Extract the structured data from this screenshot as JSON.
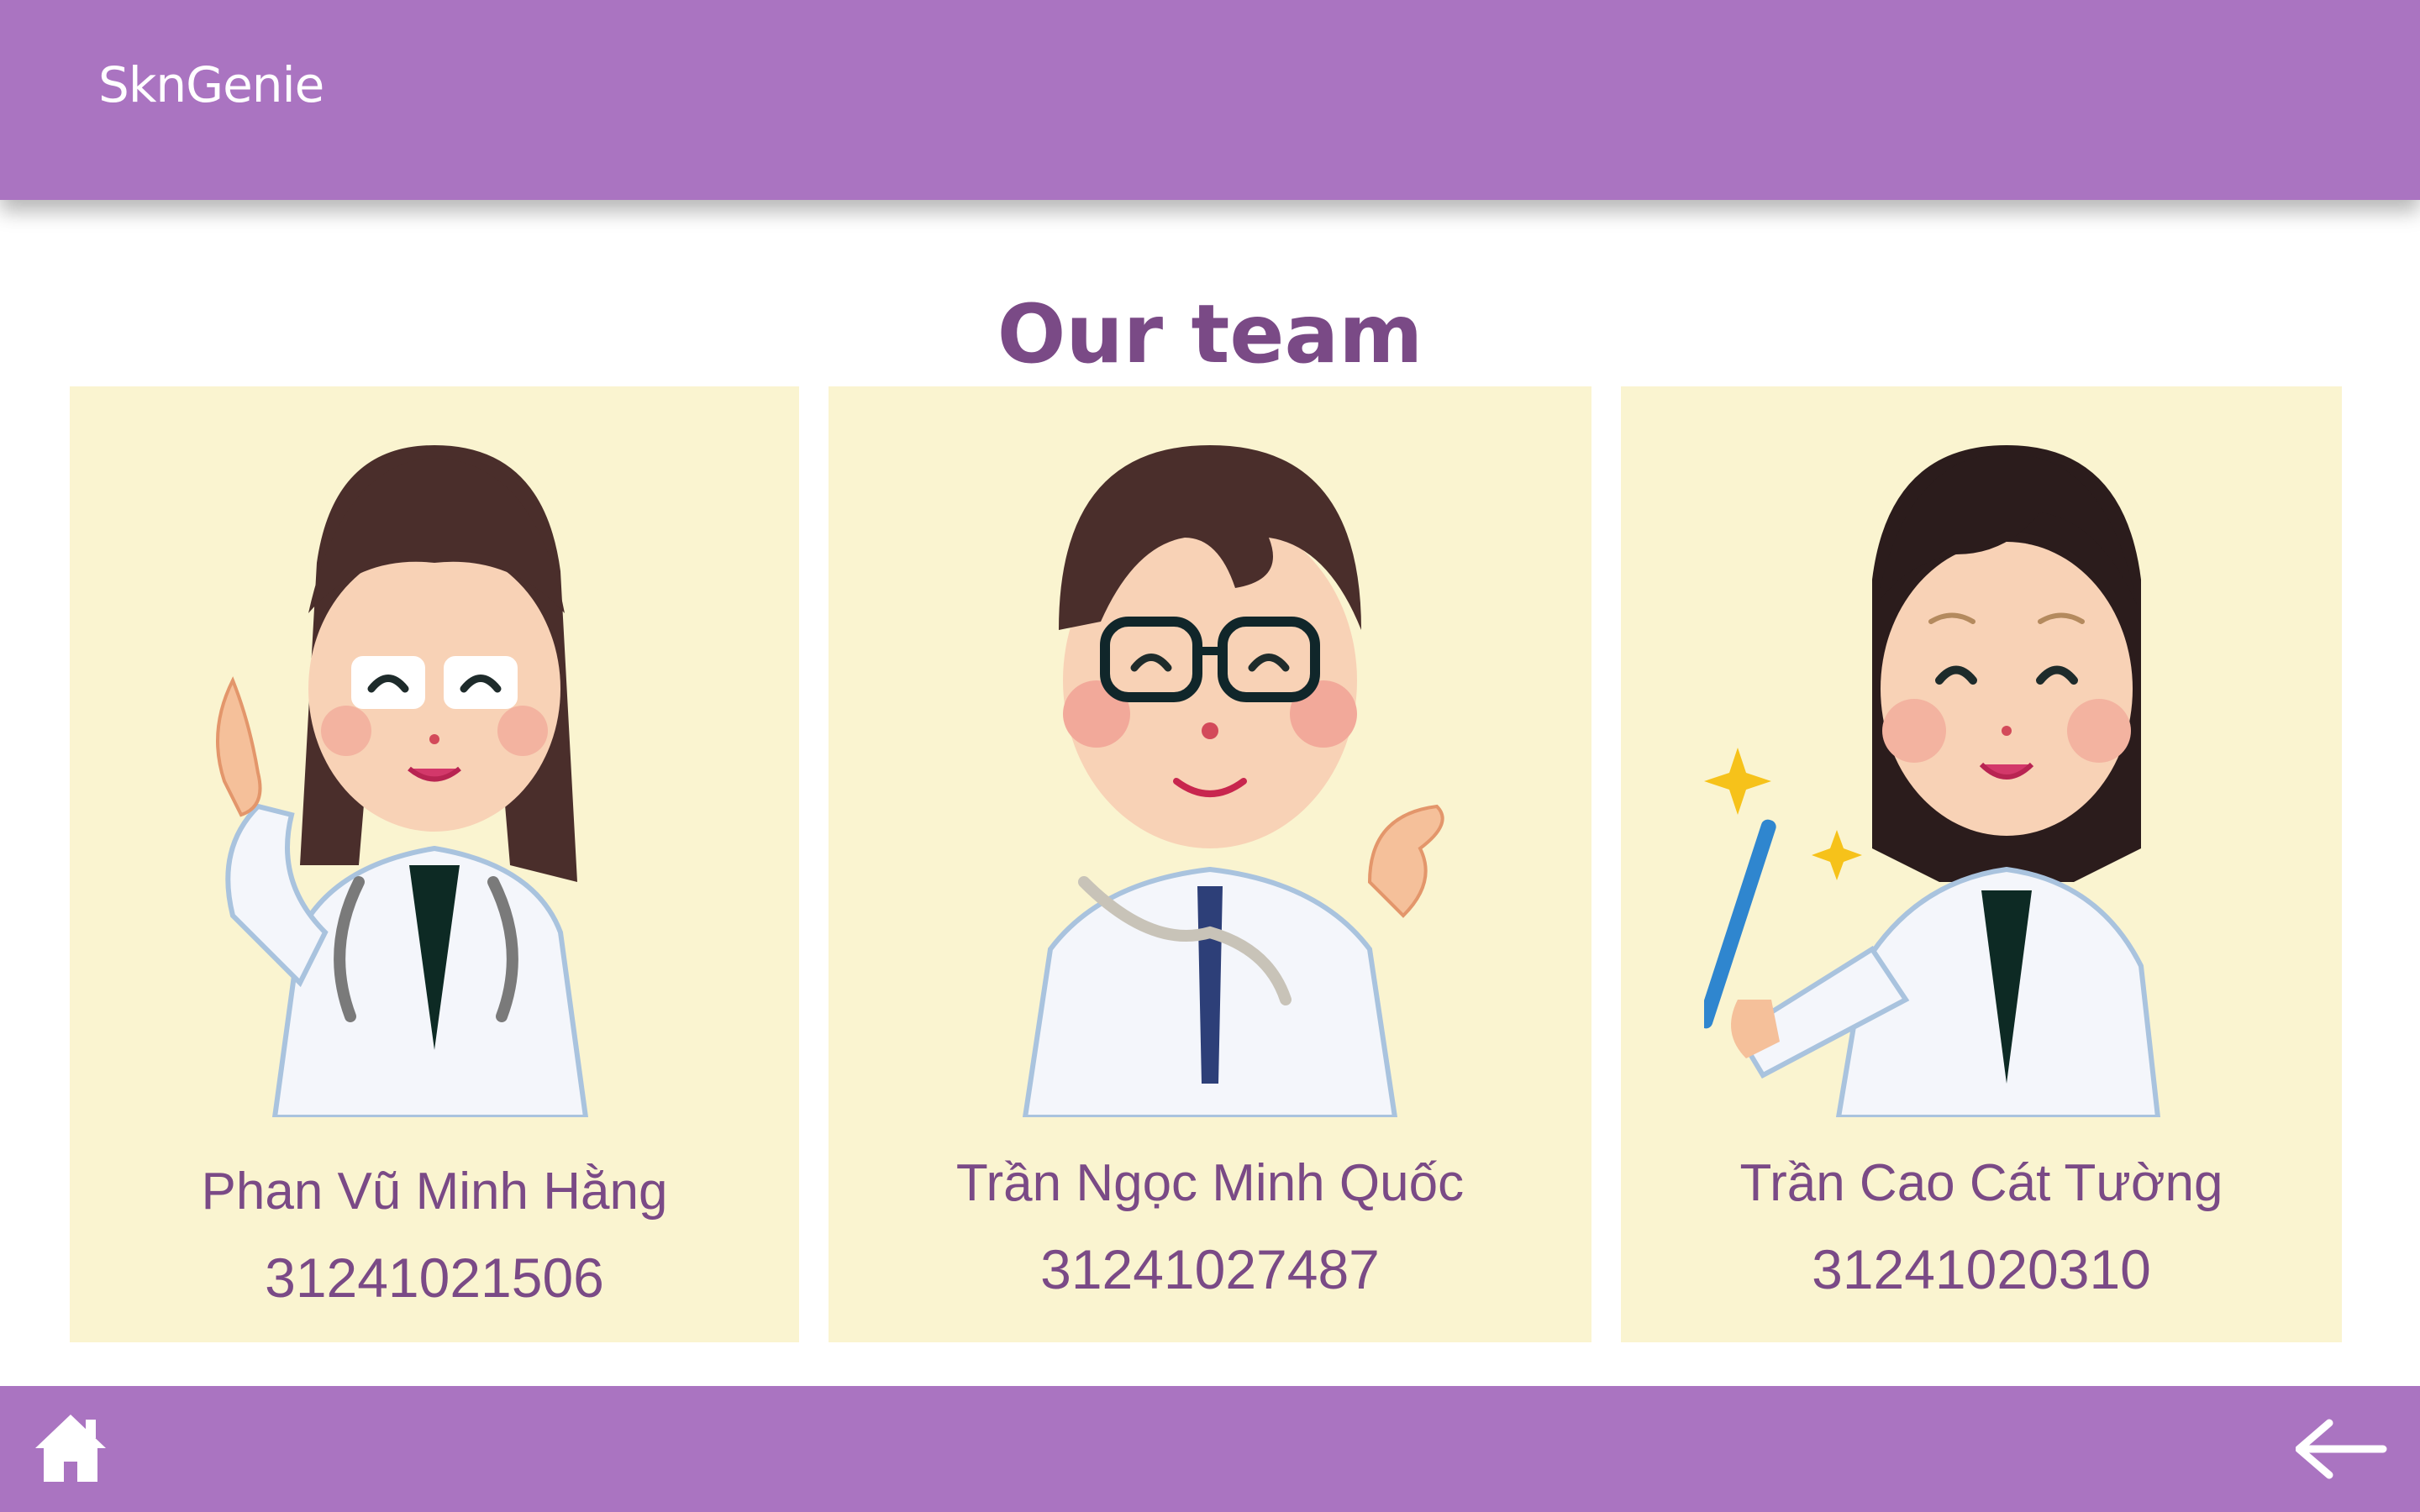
{
  "header": {
    "brand": "SknGenie"
  },
  "main": {
    "title": "Our team",
    "members": [
      {
        "name": "Phan Vũ Minh Hằng",
        "id": "31241021506"
      },
      {
        "name": "Trần Ngọc Minh Quốc",
        "id": "31241027487"
      },
      {
        "name": "Trần Cao Cát Tường",
        "id": "31241020310"
      }
    ]
  },
  "footer": {
    "home_icon": "home-icon",
    "back_icon": "arrow-left-icon"
  },
  "colors": {
    "bar": "#aa74c1",
    "title": "#7a4a86",
    "card": "#faf4d0"
  }
}
